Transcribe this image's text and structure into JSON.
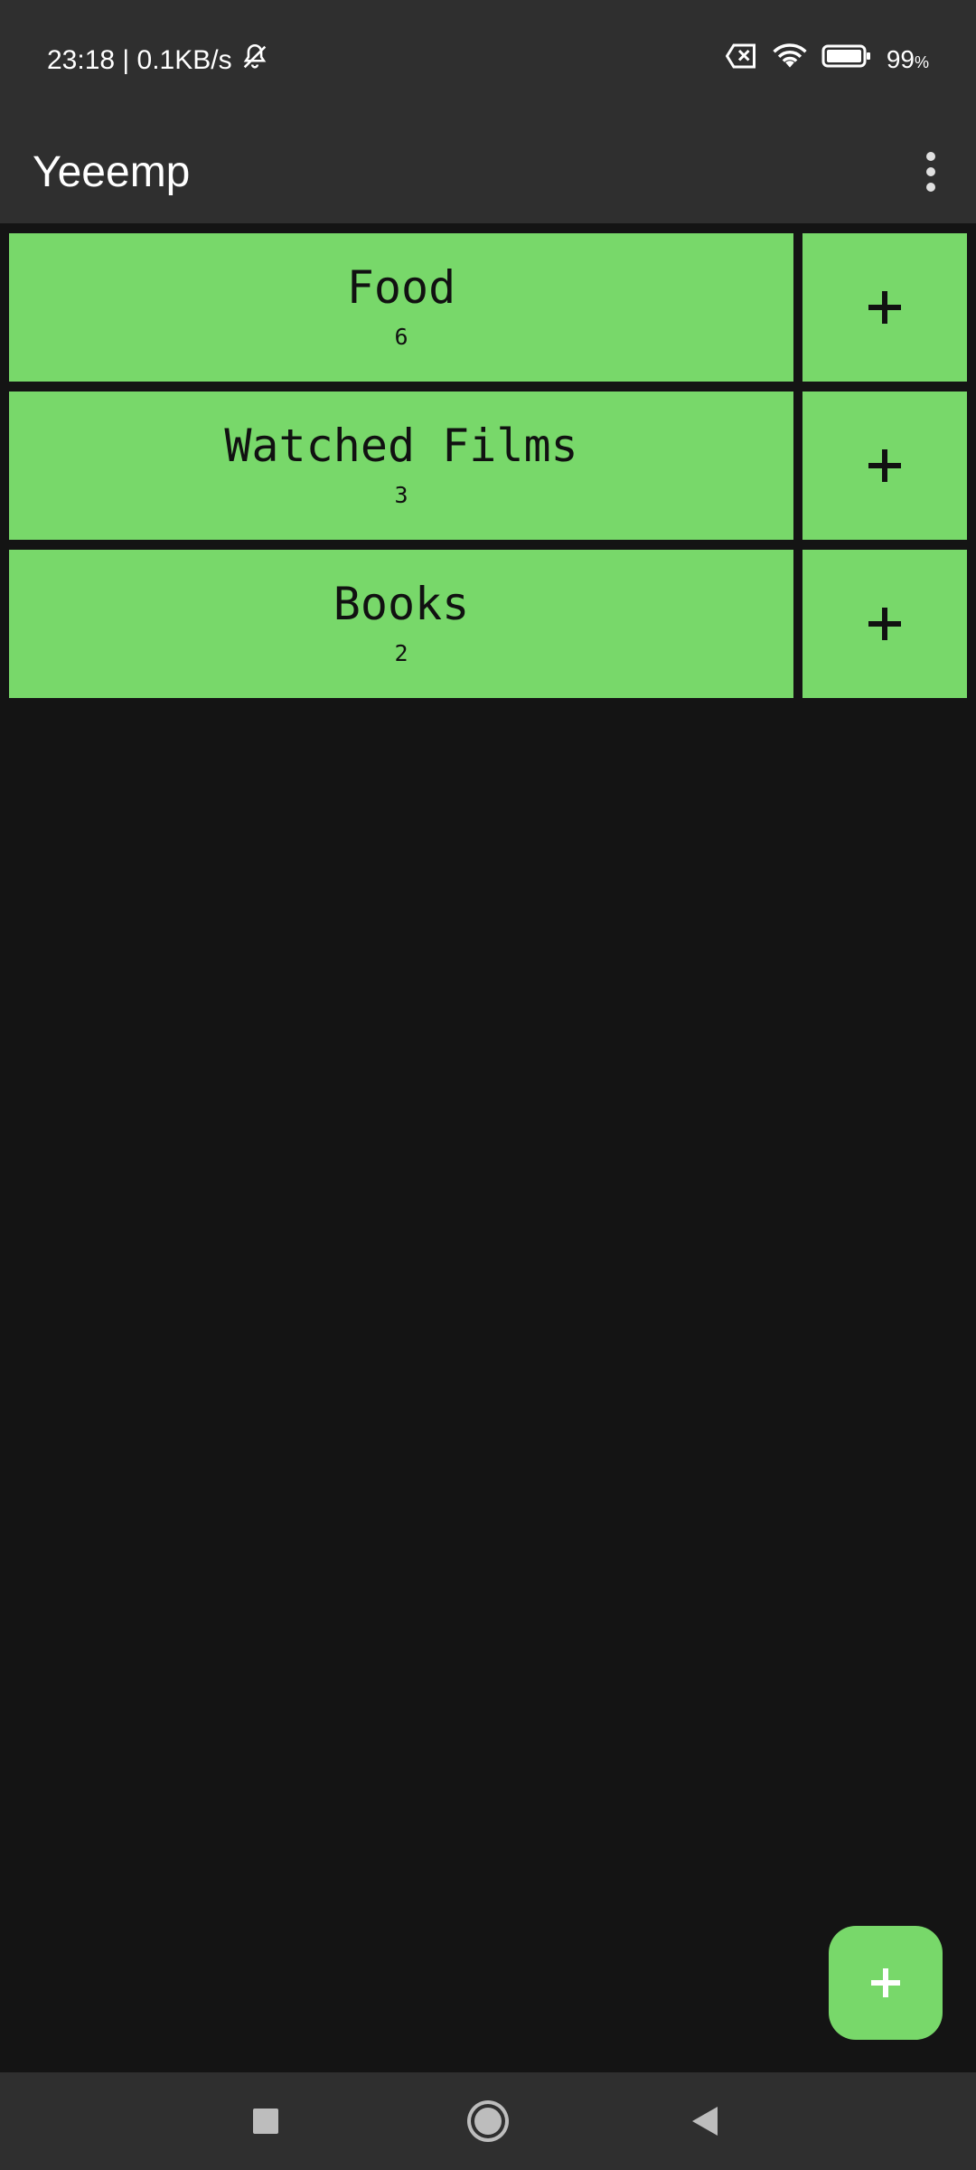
{
  "status_bar": {
    "time_speed": "23:18 | 0.1KB/s",
    "battery": "99",
    "battery_unit": "%",
    "icons": [
      "bell-muted-icon",
      "sim-x-icon",
      "wifi-icon",
      "battery-icon"
    ]
  },
  "app_bar": {
    "title": "Yeeemp",
    "menu_icon": "more-vertical-icon"
  },
  "lists": [
    {
      "title": "Food",
      "count": "6"
    },
    {
      "title": "Watched Films",
      "count": "3"
    },
    {
      "title": "Books",
      "count": "2"
    }
  ],
  "colors": {
    "accent": "#78d86a",
    "background": "#141414",
    "bar": "#2f2f2f"
  }
}
